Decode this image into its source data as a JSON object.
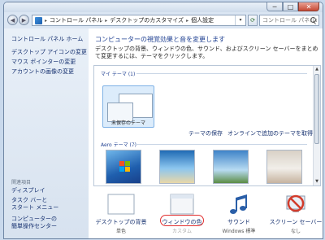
{
  "window": {
    "min_glyph": "─",
    "max_glyph": "□",
    "close_glyph": "✕"
  },
  "address": {
    "seg1": "コントロール パネル",
    "seg2": "デスクトップのカスタマイズ",
    "seg3": "個人設定",
    "sep": "▸",
    "dropdown_glyph": "▾"
  },
  "search": {
    "placeholder": "コントロール パネルの検索"
  },
  "sidebar": {
    "home": "コントロール パネル ホーム",
    "items": [
      "デスクトップ アイコンの変更",
      "マウス ポインターの変更",
      "アカウントの画像の変更"
    ],
    "related_label": "関連項目",
    "related": [
      "ディスプレイ",
      "タスク バーと",
      "スタート メニュー",
      "コンピューターの",
      "簡単操作センター"
    ]
  },
  "main": {
    "heading": "コンピューターの視覚効果と音を変更します",
    "description": "デスクトップの背景、ウィンドウの色、サウンド、およびスクリーン セーバーをまとめて変更するには、テーマをクリックします。",
    "my_themes_label": "マイ テーマ (1)",
    "unsaved_theme_label": "未保存のテーマ",
    "save_theme_link": "テーマの保存",
    "online_themes_link": "オンラインで追加のテーマを取得",
    "aero_label": "Aero テーマ (7)"
  },
  "bottom": {
    "background_label": "デスクトップの背景",
    "background_sub": "単色",
    "color_label": "ウィンドウの色",
    "color_sub": "カスタム",
    "sound_label": "サウンド",
    "sound_sub": "Windows 標準",
    "screensaver_label": "スクリーン セーバー",
    "screensaver_sub": "なし"
  },
  "colors": {
    "link": "#15306f",
    "heading": "#1e3f91",
    "highlight": "#e23030",
    "selection": "#dcecfb"
  }
}
